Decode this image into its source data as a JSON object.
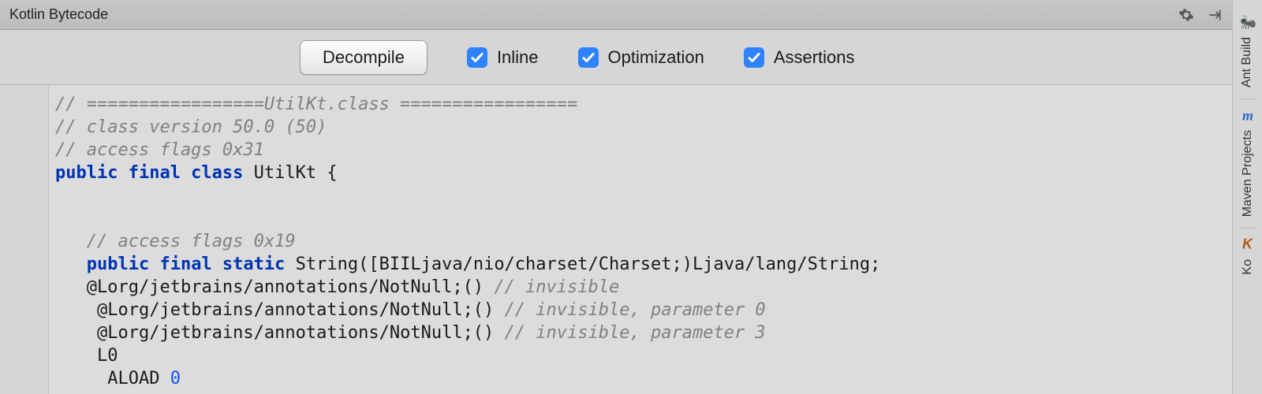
{
  "header": {
    "title": "Kotlin Bytecode"
  },
  "toolbar": {
    "decompile_label": "Decompile",
    "checks": [
      {
        "label": "Inline",
        "checked": true
      },
      {
        "label": "Optimization",
        "checked": true
      },
      {
        "label": "Assertions",
        "checked": true
      }
    ]
  },
  "code": {
    "pad": "   ",
    "pad2": "    ",
    "pad3": "     ",
    "l1_pre": "// =================",
    "l1_mid": "UtilKt.class",
    "l1_post": " =================",
    "l2": "// class version 50.0 (50)",
    "l3": "// access flags 0x31",
    "l4_kw": "public final class ",
    "l4_name": "UtilKt {",
    "l7": "// access flags 0x19",
    "l8_kw": "public final static ",
    "l8_sig": "String([BIILjava/nio/charset/Charset;)Ljava/lang/String;",
    "l9_a": "@Lorg/jetbrains/annotations/NotNull;() ",
    "l9_c": "// invisible",
    "l10_a": "@Lorg/jetbrains/annotations/NotNull;() ",
    "l10_c": "// invisible, parameter 0",
    "l11_a": "@Lorg/jetbrains/annotations/NotNull;() ",
    "l11_c": "// invisible, parameter 3",
    "l12": "L0",
    "l13_a": "ALOAD ",
    "l13_n": "0"
  },
  "sidebar": {
    "tabs": [
      {
        "label": "Ant Build",
        "icon": "ant"
      },
      {
        "label": "Maven Projects",
        "icon": "maven"
      },
      {
        "label": "Ko",
        "icon": "kotlin"
      }
    ]
  }
}
